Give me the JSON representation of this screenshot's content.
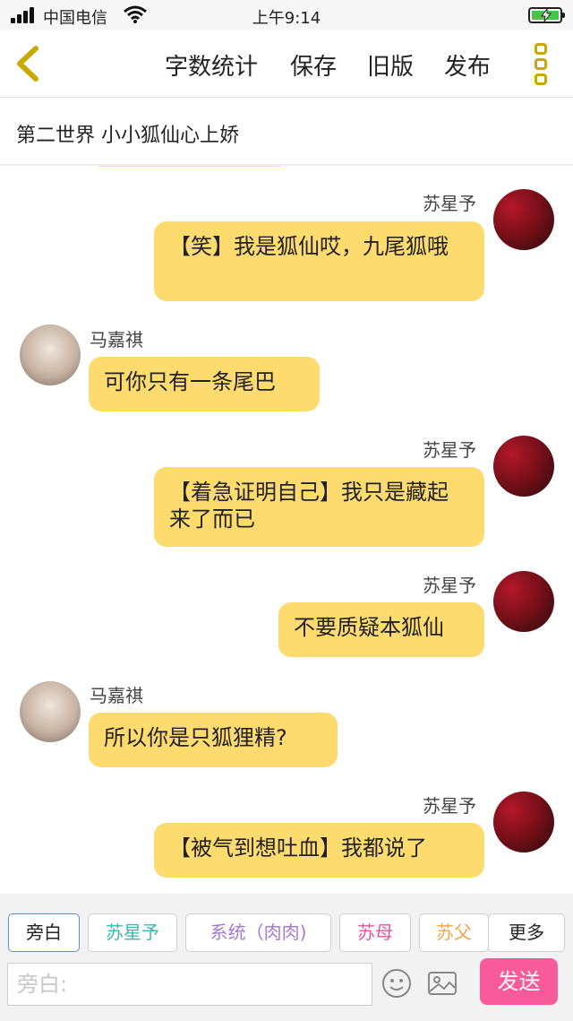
{
  "status_bar": {
    "carrier": "中国电信",
    "time": "上午9:14"
  },
  "nav": {
    "word_count": "字数统计",
    "save": "保存",
    "old_version": "旧版",
    "publish": "发布"
  },
  "chapter": {
    "title": "第二世界 小小狐仙心上娇"
  },
  "messages": [
    {
      "name": "苏星予",
      "text": "【笑】我是狐仙哎，九尾狐哦"
    },
    {
      "name": "马嘉祺",
      "text": "可你只有一条尾巴"
    },
    {
      "name": "苏星予",
      "text": "【着急证明自己】我只是藏起来了而已"
    },
    {
      "name": "苏星予",
      "text": "不要质疑本狐仙"
    },
    {
      "name": "马嘉祺",
      "text": "所以你是只狐狸精?"
    },
    {
      "name": "苏星予",
      "text": "【被气到想吐血】我都说了"
    }
  ],
  "roles": [
    {
      "label": "旁白",
      "color": "#222222"
    },
    {
      "label": "苏星予",
      "color": "#3fb6b0"
    },
    {
      "label": "系统（肉肉)",
      "color": "#a57ad2"
    },
    {
      "label": "苏母",
      "color": "#e0559b"
    },
    {
      "label": "苏父",
      "color": "#f0a64f"
    },
    {
      "label": "更多",
      "color": "#222222"
    }
  ],
  "composer": {
    "placeholder": "旁白:",
    "send": "发送"
  },
  "icons": {
    "back": "chevron-left-icon",
    "menu": "vertical-dots-icon",
    "emoji": "smiley-icon",
    "image": "image-icon"
  },
  "colors": {
    "accent": "#fedb6f",
    "send": "#f95b9a",
    "battery": "#3ec94a"
  }
}
